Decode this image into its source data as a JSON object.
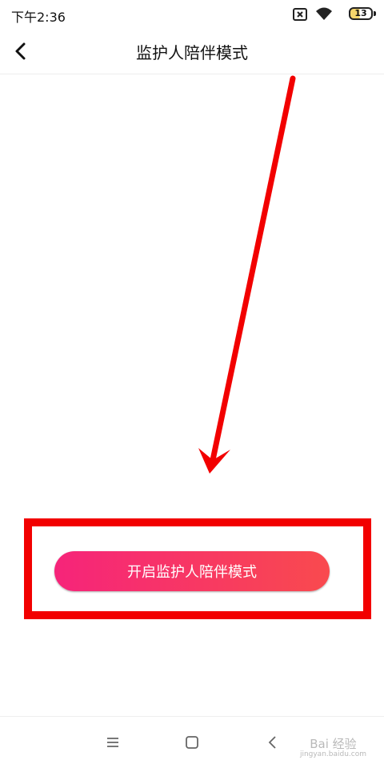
{
  "status_bar": {
    "time": "下午2:36",
    "battery": "13"
  },
  "header": {
    "title": "监护人陪伴模式"
  },
  "main": {
    "enable_button_label": "开启监护人陪伴模式"
  },
  "colors": {
    "button_gradient_start": "#f6247a",
    "button_gradient_end": "#f94a4e",
    "annotation_red": "#f20000"
  },
  "watermark": {
    "brand": "Bai 经验",
    "url": "jingyan.baidu.com"
  },
  "icons": [
    "sim-x-icon",
    "wifi-icon",
    "battery-icon",
    "back-arrow-icon",
    "menu-icon",
    "home-icon",
    "back-nav-icon"
  ]
}
